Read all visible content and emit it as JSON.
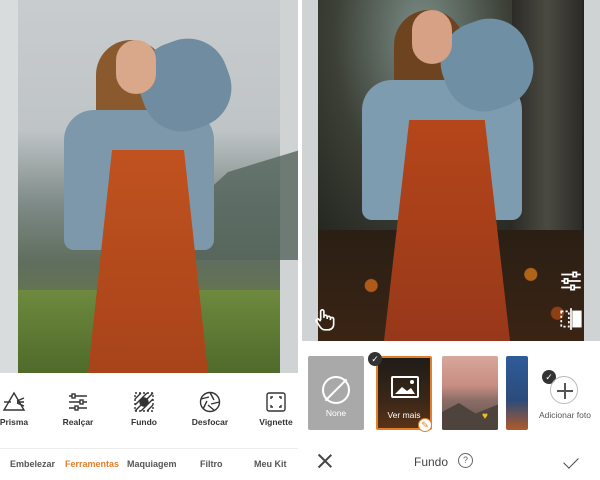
{
  "left_panel": {
    "tools": [
      {
        "label": "Prisma",
        "icon": "prism-icon"
      },
      {
        "label": "Realçar",
        "icon": "sliders-icon"
      },
      {
        "label": "Fundo",
        "icon": "background-icon"
      },
      {
        "label": "Desfocar",
        "icon": "aperture-icon"
      },
      {
        "label": "Vignette",
        "icon": "vignette-icon"
      }
    ],
    "tabs": [
      {
        "label": "Embelezar",
        "active": false
      },
      {
        "label": "Ferramentas",
        "active": true
      },
      {
        "label": "Maquiagem",
        "active": false
      },
      {
        "label": "Filtro",
        "active": false
      },
      {
        "label": "Meu Kit",
        "active": false
      }
    ]
  },
  "right_panel": {
    "overlay_icons": [
      "hand-pointer-icon",
      "sliders-icon",
      "compare-icon"
    ],
    "thumbnails": [
      {
        "label": "None"
      },
      {
        "label": "Ver mais"
      },
      {
        "label": ""
      },
      {
        "label": ""
      }
    ],
    "add_photo_label": "Adicionar foto",
    "bottom_bar": {
      "title": "Fundo",
      "help_glyph": "?"
    }
  },
  "colors": {
    "accent": "#e27f2d",
    "text": "#333333"
  }
}
